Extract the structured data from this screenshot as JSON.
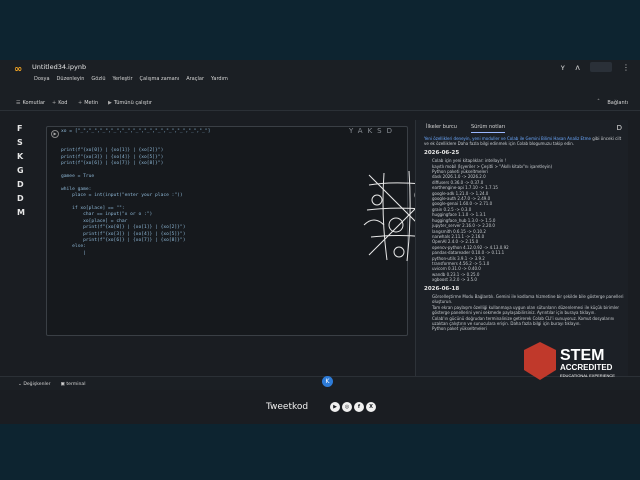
{
  "header": {
    "file_name": "Untitled34.ipynb",
    "menu": [
      "Dosya",
      "Düzenleyin",
      "Gözlü",
      "Yerleştir",
      "Çalışma zamanı",
      "Araçlar",
      "Yardım"
    ],
    "share_label": "Paylaş"
  },
  "toolbar": {
    "commands": "Komutlar",
    "code": "Kod",
    "text": "Metin",
    "run_all": "Tümünü çalıştır",
    "connect": "Bağlantı"
  },
  "rail_letters": [
    "F",
    "S",
    "K",
    "G",
    "D",
    "D",
    "M"
  ],
  "cell": {
    "prompt": "[1]",
    "watermark": "YAKSD",
    "code_lines": [
      "xo = [\"_\",\"_\",\"_\",\"_\",\"_\",\"_\",\"_\",\"_\",\"_\",\"_\",\"_\",\"_\"]",
      "",
      "",
      "print(f\"{xo[0]} | {xo[1]} | {xo[2]}\")",
      "print(f\"{xo[3]} | {xo[4]} | {xo[5]}\")",
      "print(f\"{xo[6]} | {xo[7]} | {xo[8]}\")",
      "",
      "gamee = True",
      "",
      "while game:",
      "    place = int(input(\"enter your place :\"))",
      "",
      "    if xo[place] == \"\":",
      "        char == input(\"x or o :\")",
      "        xo[place] = char",
      "        print(f\"{xo[0]} | {xo[1]} | {xo[2]}\")",
      "        print(f\"{xo[3]} | {xo[4]} | {xo[5]}\")",
      "        print(f\"{xo[6]} | {xo[7]} | {xo[8]}\")",
      "    else:",
      "        |"
    ]
  },
  "panel": {
    "tabs": [
      "İlkeler burcu",
      "Sürüm notları"
    ],
    "intro_link": "Yeni özellikleri deneyin, yeni moduller ve Colab ile Gemini Bilimi Hasan Analiz Etme",
    "intro_text": "gibi önceki cilt ve ek özelliklere Daha fazla bilgi edinmek için Colab blogumuzu takip edin.",
    "date1": "2026-06-25",
    "items1": [
      "Colab için yeni kitaplıklar: intellayin !",
      "kayıtlı mobil (İşyeriler > Çeşitli > \"Akıllı kitabı\"nı işaretleyin)",
      "Python paketi yükseltmeleri",
      "dask 2026.1.0 -> 2026.2.0",
      "diffusers 0.36.0 -> 0.37.0",
      "earthengine-api 1.7.10 -> 1.7.15",
      "google-adk 1.21.0 -> 1.24.0",
      "google-auth 2.47.0 -> 2.49.0",
      "google-genai 1.60.0 -> 2.71.0",
      "grain 0.2.5 -> 0.3.0",
      "huggingface 1.1.0 -> 1.3.1",
      "huggingface_hub 1.3.0 -> 1.5.0",
      "jupyter_server 2.16.0 -> 2.20.0",
      "langsmith 0.6.15 -> 0.10.2",
      "narwhals 2.11.1 -> 2.16.0",
      "OpenAI 2.4.0 -> 2.15.0",
      "opencv-python 4.12.0.92 -> 4.13.0.92",
      "pandas-datareader 0.10.0 -> 0.11.1",
      "python-utils 3.9.1 -> 3.9.2",
      "transformers 4.56.2 -> 5.1.0",
      "uvicorn 0.31.0 -> 0.40.0",
      "wandb 0.23.1 -> 0.25.0",
      "xgboost 3.2.0 -> 3.5.0"
    ],
    "date2": "2026-06-18",
    "items2": [
      "Görselleştirme Modu Bağlantılı. Gemini ile kodlama hizmetine bir şekilde bile gösterge panelleri oluşturun.",
      "Tam ekran paylaşım özelliği kullanmaya uygun olan sütunların düzenlemesi ile küçük birimler gösterge panellerini yeni sekmede paylaşabilirsiniz. Ayrıntılar için buraya tıklayın.",
      "Colab'ın gücünü doğrudan terminalinize getirerek Colab CLI'i sunuyoruz. Komut dosyalarını uzaktan çalıştırın ve sunuculara erişin. Daha fazla bilgi için burayı tıklayın.",
      "Python paket yükseltmeleri"
    ]
  },
  "status": {
    "variables": "Değişkenler",
    "terminal": "terminal"
  },
  "footer": {
    "brand": "Tweetkod",
    "socials": [
      "youtube-icon",
      "instagram-icon",
      "facebook-icon",
      "x-icon"
    ]
  },
  "badge": {
    "title": "STEM",
    "line1": "ACCREDITED",
    "line2": "EDUCATIONAL EXPERIENCE"
  },
  "colors": {
    "accent": "#f5a623",
    "link": "#6aa8ff",
    "badge_red": "#c0392b"
  }
}
